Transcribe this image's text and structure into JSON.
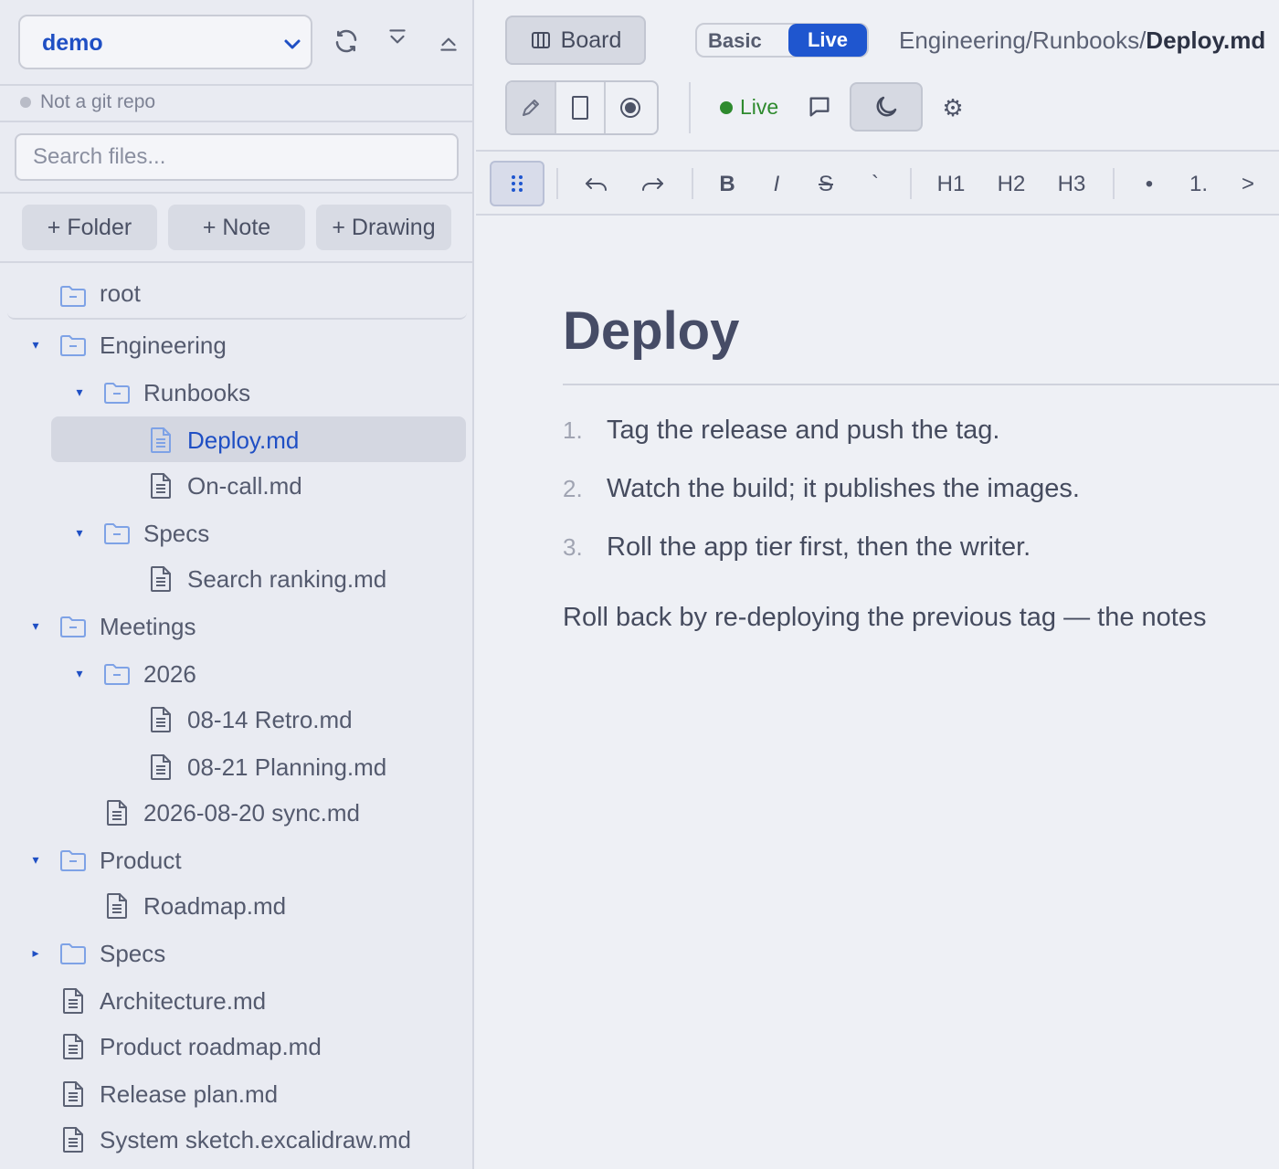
{
  "sidebar": {
    "repo": {
      "name": "demo"
    },
    "git_status": "Not a git repo",
    "search": {
      "placeholder": "Search files..."
    },
    "actions": {
      "folder": "+ Folder",
      "note": "+ Note",
      "drawing": "+ Drawing"
    },
    "root_label": "root",
    "tree": [
      {
        "label": "Engineering",
        "type": "folder",
        "expanded": true,
        "depth": 0
      },
      {
        "label": "Runbooks",
        "type": "folder",
        "expanded": true,
        "depth": 1
      },
      {
        "label": "Deploy.md",
        "type": "file",
        "depth": 2,
        "selected": true
      },
      {
        "label": "On-call.md",
        "type": "file",
        "depth": 2
      },
      {
        "label": "Specs",
        "type": "folder",
        "expanded": true,
        "depth": 1
      },
      {
        "label": "Search ranking.md",
        "type": "file",
        "depth": 2
      },
      {
        "label": "Meetings",
        "type": "folder",
        "expanded": true,
        "depth": 0
      },
      {
        "label": "2026",
        "type": "folder",
        "expanded": true,
        "depth": 1
      },
      {
        "label": "08-14 Retro.md",
        "type": "file",
        "depth": 2
      },
      {
        "label": "08-21 Planning.md",
        "type": "file",
        "depth": 2
      },
      {
        "label": "2026-08-20 sync.md",
        "type": "file",
        "depth": 1
      },
      {
        "label": "Product",
        "type": "folder",
        "expanded": true,
        "depth": 0
      },
      {
        "label": "Roadmap.md",
        "type": "file",
        "depth": 1
      },
      {
        "label": "Specs",
        "type": "folder",
        "expanded": false,
        "depth": 0
      },
      {
        "label": "Architecture.md",
        "type": "file",
        "depth": 0
      },
      {
        "label": "Product roadmap.md",
        "type": "file",
        "depth": 0
      },
      {
        "label": "Release plan.md",
        "type": "file",
        "depth": 0
      },
      {
        "label": "System sketch.excalidraw.md",
        "type": "file",
        "depth": 0
      }
    ]
  },
  "header": {
    "board_label": "Board",
    "mode": {
      "basic": "Basic",
      "live": "Live",
      "selected": "Live"
    },
    "breadcrumb": {
      "path": "Engineering/Runbooks/",
      "current": "Deploy.md"
    },
    "live_status": "Live"
  },
  "format_toolbar": {
    "bold": "B",
    "italic": "I",
    "strike": "S",
    "code": "`",
    "h1": "H1",
    "h2": "H2",
    "h3": "H3",
    "bullet": "•",
    "numbered": "1.",
    "quote": ">"
  },
  "document": {
    "title": "Deploy",
    "steps": [
      {
        "num": "1.",
        "text": "Tag the release and push the tag."
      },
      {
        "num": "2.",
        "text": "Watch the build; it publishes the images."
      },
      {
        "num": "3.",
        "text": "Roll the app tier first, then the writer."
      }
    ],
    "paragraph": "Roll back by re-deploying the previous tag — the notes"
  },
  "colors": {
    "accent": "#1f56cf",
    "live_green": "#2e8a2e",
    "selected_row": "#d4d7e1"
  }
}
